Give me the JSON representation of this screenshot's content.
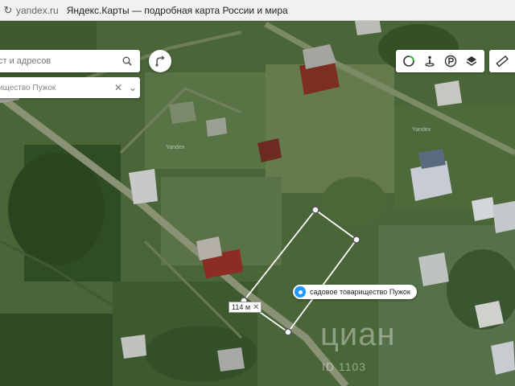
{
  "browser": {
    "domain": "yandex.ru",
    "tab_title": "Яндекс.Карты — подробная карта России и мира"
  },
  "search": {
    "placeholder": "ст и адресов"
  },
  "result": {
    "text": "ищество Пужок"
  },
  "controls": [
    "traffic-icon",
    "panorama-icon",
    "parking-icon",
    "layers-icon",
    "ruler-icon"
  ],
  "measure": {
    "distance_label": "114 м"
  },
  "place": {
    "label": "садовое товарищество Пужок"
  },
  "watermark": {
    "brand": "циан",
    "id": "ID 1103"
  },
  "map_labels": {
    "yandex_1": "Yandex",
    "yandex_2": "Yandex"
  },
  "colors": {
    "accent": "#1e98ff",
    "measure_line": "#ffffff"
  }
}
